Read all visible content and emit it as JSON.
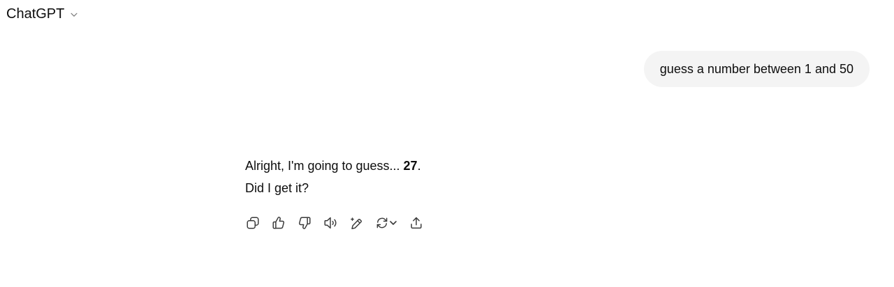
{
  "header": {
    "model_name": "ChatGPT",
    "model_chevron_icon": "chevron-down-icon"
  },
  "conversation": {
    "user_message": "guess a number between 1 and 50",
    "assistant": {
      "line1_prefix": "Alright, I'm going to guess... ",
      "line1_bold": "27",
      "line1_suffix": ".",
      "line2": "Did I get it?"
    }
  },
  "actions": [
    {
      "name": "copy",
      "icon": "copy-icon"
    },
    {
      "name": "good-response",
      "icon": "thumbs-up-icon"
    },
    {
      "name": "bad-response",
      "icon": "thumbs-down-icon"
    },
    {
      "name": "read-aloud",
      "icon": "speaker-icon"
    },
    {
      "name": "edit-in-canvas",
      "icon": "pencil-sparkle-icon"
    },
    {
      "name": "switch-model",
      "icon": "refresh-icon"
    },
    {
      "name": "share",
      "icon": "share-icon"
    }
  ],
  "colors": {
    "bubble_bg": "#f4f4f4",
    "text": "#0d0d0d",
    "icon": "#5d5d5d"
  }
}
